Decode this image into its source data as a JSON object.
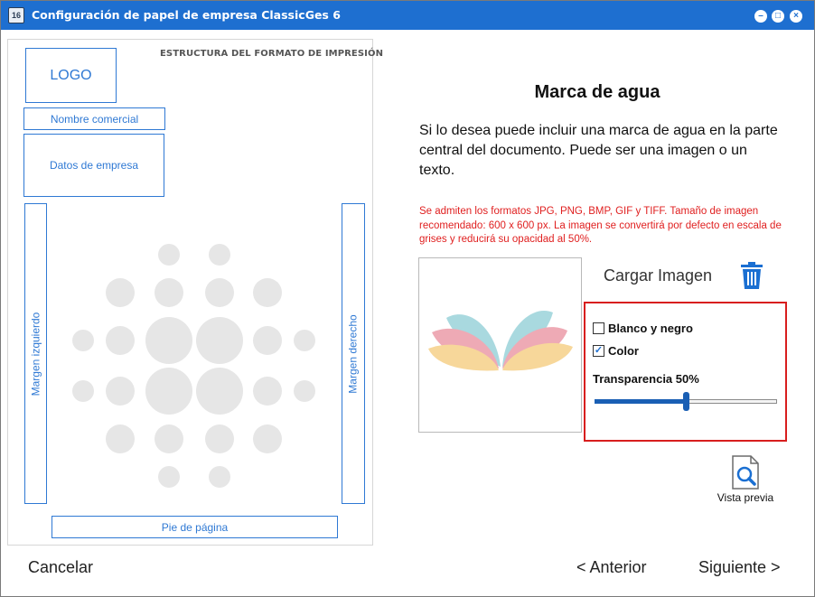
{
  "window": {
    "title": "Configuración de papel de empresa ClassicGes 6",
    "app_icon_text": "16",
    "controls": {
      "minimize": "minimize-icon",
      "maximize": "maximize-icon",
      "close": "close-icon"
    }
  },
  "structure": {
    "title": "ESTRUCTURA DEL FORMATO DE IMPRESIÓN",
    "logo": "LOGO",
    "trade_name": "Nombre comercial",
    "company_data": "Datos de empresa",
    "left_margin": "Margen izquierdo",
    "right_margin": "Margen derecho",
    "footer": "Pie de página",
    "watermark_placeholder_color": "#e6e6e6"
  },
  "watermark": {
    "heading": "Marca de agua",
    "description": "Si lo desea puede incluir una marca de agua en la parte central del documento. Puede ser una imagen o un texto.",
    "note": "Se admiten los formatos JPG, PNG, BMP, GIF y TIFF. Tamaño de imagen recomendado: 600 x 600 px. La imagen se convertirá por defecto en escala de grises y reducirá su opacidad al 50%.",
    "load_image_label": "Cargar Imagen",
    "delete_icon": "trash-icon",
    "options": {
      "bw_label": "Blanco y negro",
      "bw_checked": false,
      "color_label": "Color",
      "color_checked": true,
      "transparency_label": "Transparencia 50%",
      "transparency_value": 0.5
    },
    "preview_label": "Vista previa",
    "preview_icon": "document-magnifier-icon"
  },
  "footer_nav": {
    "cancel": "Cancelar",
    "previous": "< Anterior",
    "next": "Siguiente >"
  },
  "colors": {
    "title_bar": "#1e6fd0",
    "outline_blue": "#2f79d4",
    "note_red": "#e02020",
    "highlight_red": "#d81e1e",
    "slider_blue": "#1a5fb4"
  }
}
